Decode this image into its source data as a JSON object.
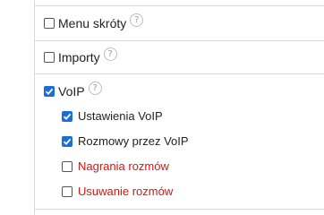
{
  "items": [
    {
      "label": "Menu skróty",
      "checked": false,
      "help": "?"
    },
    {
      "label": "Importy",
      "checked": false,
      "help": "?"
    },
    {
      "label": "VoIP",
      "checked": true,
      "help": "?"
    }
  ],
  "sub_items": [
    {
      "label": "Ustawienia VoIP",
      "checked": true
    },
    {
      "label": "Rozmowy przez VoIP",
      "checked": true
    },
    {
      "label": "Nagrania rozmów",
      "checked": false,
      "color": "#dd1111"
    },
    {
      "label": "Usuwanie rozmów",
      "checked": false,
      "color": "#dd1111"
    }
  ],
  "colors": {
    "accent": "#1a6ed8",
    "danger": "#dd1111",
    "divider": "#d9d9d9"
  }
}
